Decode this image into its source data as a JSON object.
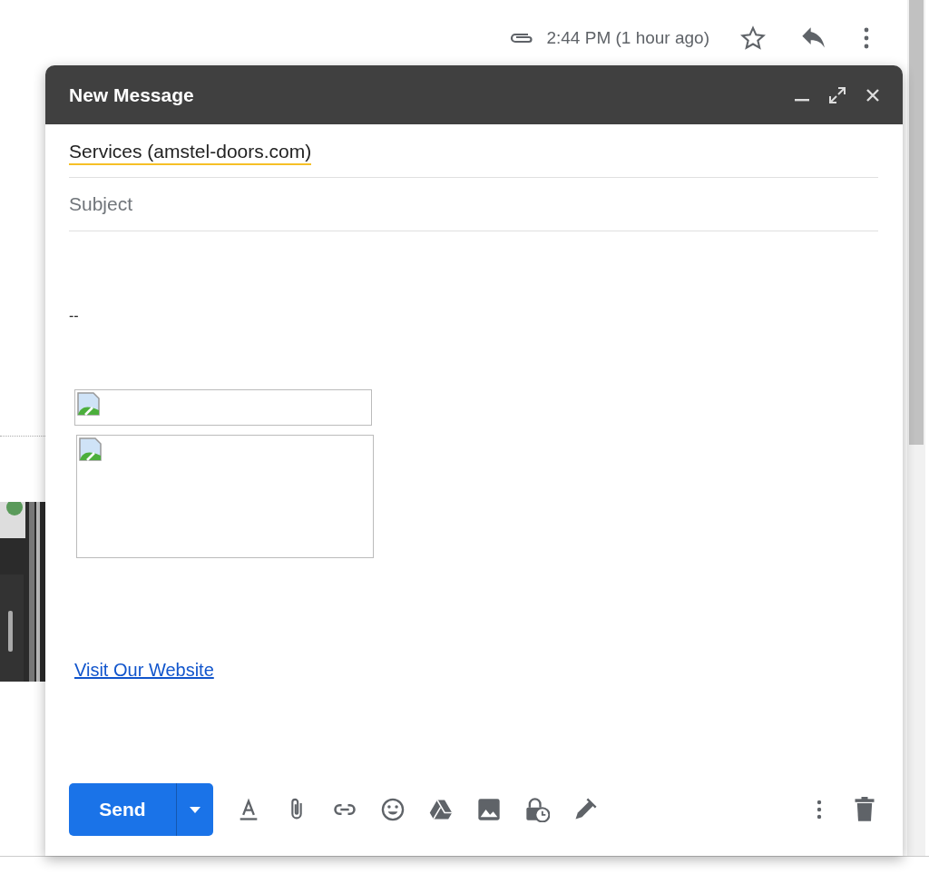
{
  "message_header": {
    "time": "2:44 PM (1 hour ago)",
    "starred": false
  },
  "compose": {
    "title": "New Message",
    "to": "Services (amstel-doors.com)",
    "subject": {
      "placeholder": "Subject"
    },
    "body": {
      "separator": "--",
      "images": [
        {
          "kind": "banner"
        },
        {
          "kind": "block"
        }
      ],
      "link": "Visit Our Website"
    },
    "send_label": "Send"
  }
}
